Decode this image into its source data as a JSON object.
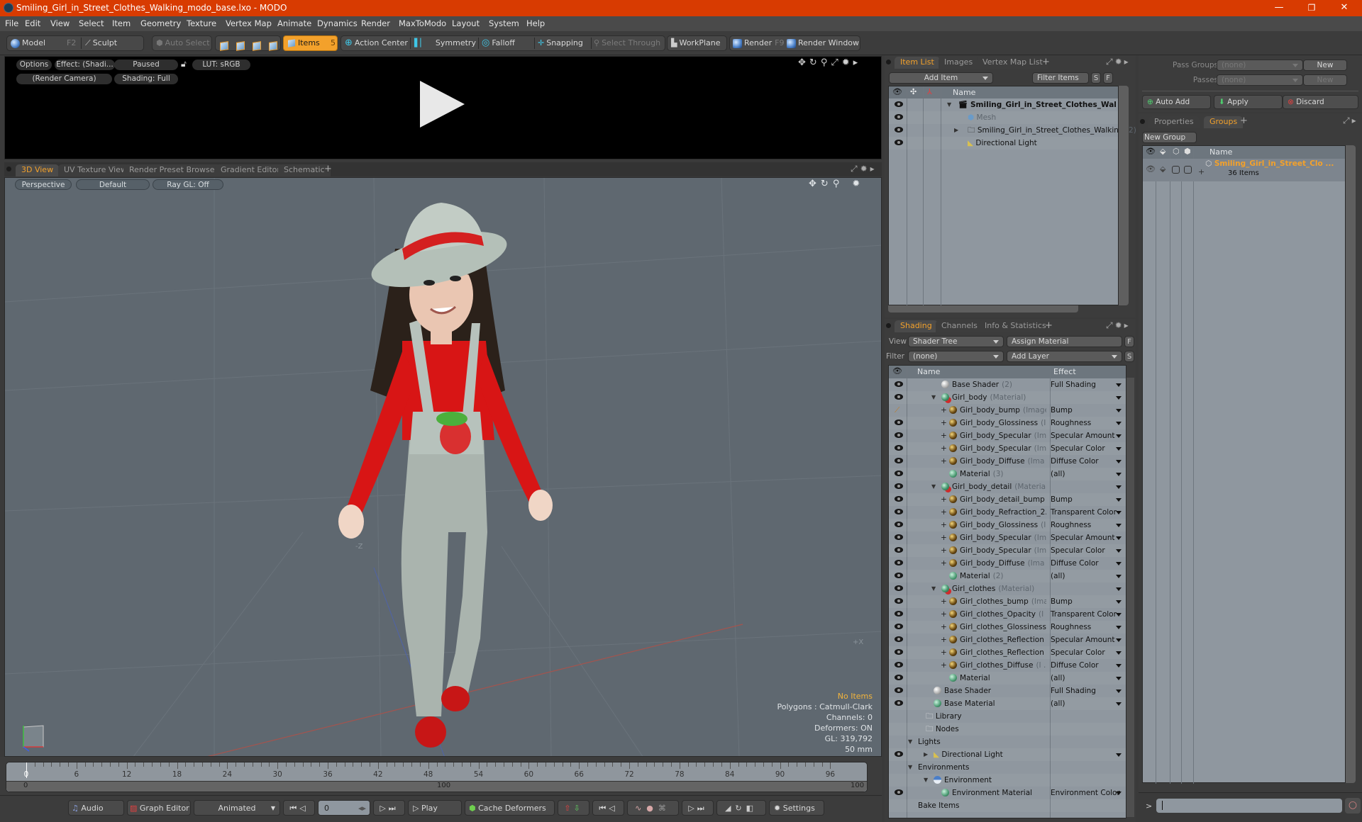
{
  "window": {
    "title": "Smiling_Girl_in_Street_Clothes_Walking_modo_base.lxo - MODO",
    "controls": {
      "minimize": "—",
      "restore": "❐",
      "close": "✕"
    }
  },
  "menu": [
    "File",
    "Edit",
    "View",
    "Select",
    "Item",
    "Geometry",
    "Texture",
    "Vertex Map",
    "Animate",
    "Dynamics",
    "Render",
    "MaxToModo",
    "Layout",
    "System",
    "Help"
  ],
  "toolbar": {
    "model": "Model",
    "model_key": "F2",
    "sculpt": "Sculpt",
    "auto_select": "Auto Select",
    "items": "Items",
    "items_key": "5",
    "action_center": "Action Center",
    "symmetry": "Symmetry",
    "falloff": "Falloff",
    "snapping": "Snapping",
    "select_through": "Select Through",
    "workplane": "WorkPlane",
    "render": "Render",
    "render_key": "F9",
    "render_window": "Render Window"
  },
  "render_preview": {
    "options": "Options",
    "effect": "Effect: (Shadi...",
    "paused": "Paused",
    "lut": "LUT: sRGB",
    "camera": "(Render Camera)",
    "shading": "Shading: Full"
  },
  "viewport_tabs": [
    "3D View",
    "UV Texture View",
    "Render Preset Browser",
    "Gradient Editor",
    "Schematic",
    "+"
  ],
  "viewport": {
    "projection": "Perspective",
    "style": "Default",
    "raygl": "Ray GL: Off",
    "axis_labels": {
      "x": "+X",
      "z": "-Z"
    },
    "stats": {
      "selection": "No Items",
      "polygons": "Polygons : Catmull-Clark",
      "channels": "Channels: 0",
      "deformers": "Deformers: ON",
      "gl": "GL: 319,792",
      "lens": "50 mm"
    }
  },
  "timeline": {
    "ticks": [
      "0",
      "6",
      "12",
      "18",
      "24",
      "30",
      "36",
      "42",
      "48",
      "54",
      "60",
      "66",
      "72",
      "78",
      "84",
      "90",
      "96"
    ],
    "range_start": "0",
    "range_mid": "100",
    "range_end": "100",
    "current_frame": 0
  },
  "bottom_bar": {
    "audio": "Audio",
    "graph_editor": "Graph Editor",
    "animated": "Animated",
    "frame": "0",
    "play": "Play",
    "cache_deformers": "Cache Deformers",
    "settings": "Settings"
  },
  "item_list": {
    "tabs": [
      "Item List",
      "Images",
      "Vertex Map List",
      "+"
    ],
    "add_item": "Add Item",
    "filter": "Filter Items",
    "s": "S",
    "f": "F",
    "column_name": "Name",
    "rows": [
      {
        "name": "Smiling_Girl_in_Street_Clothes_Wal ...",
        "suffix": "",
        "bold": true
      },
      {
        "name": "Mesh",
        "suffix": "",
        "dim": true
      },
      {
        "name": "Smiling_Girl_in_Street_Clothes_Walking",
        "suffix": "(2)"
      },
      {
        "name": "Directional Light",
        "suffix": ""
      }
    ]
  },
  "shading": {
    "tabs": [
      "Shading",
      "Channels",
      "Info & Statistics",
      "+"
    ],
    "view_label": "View",
    "view_value": "Shader Tree",
    "assign_material": "Assign Material",
    "f": "F",
    "filter_label": "Filter",
    "filter_value": "(none)",
    "add_layer": "Add Layer",
    "s": "S",
    "col_name": "Name",
    "col_effect": "Effect",
    "rows": [
      {
        "name": "Base Shader",
        "suffix": "(2)",
        "effect": "Full Shading",
        "icon": "white",
        "indent": 4,
        "eye": true
      },
      {
        "name": "Girl_body",
        "suffix": "(Material)",
        "effect": "",
        "icon": "mat",
        "indent": 4,
        "eye": true,
        "expand": true
      },
      {
        "name": "Girl_body_bump",
        "suffix": "(Image)",
        "effect": "Bump",
        "icon": "gold",
        "indent": 5,
        "eye": "brush",
        "plus": true
      },
      {
        "name": "Girl_body_Glossiness",
        "suffix": "(I ...",
        "effect": "Roughness",
        "icon": "gold",
        "indent": 5,
        "eye": true,
        "plus": true
      },
      {
        "name": "Girl_body_Specular",
        "suffix": "(Im ...",
        "effect": "Specular Amount",
        "icon": "gold",
        "indent": 5,
        "eye": true,
        "plus": true
      },
      {
        "name": "Girl_body_Specular",
        "suffix": "(Im ...",
        "effect": "Specular Color",
        "icon": "gold",
        "indent": 5,
        "eye": true,
        "plus": true
      },
      {
        "name": "Girl_body_Diffuse",
        "suffix": "(Ima ...",
        "effect": "Diffuse Color",
        "icon": "gold",
        "indent": 5,
        "eye": true,
        "plus": true
      },
      {
        "name": "Material",
        "suffix": "(3)",
        "effect": "(all)",
        "icon": "green",
        "indent": 5,
        "eye": true
      },
      {
        "name": "Girl_body_detail",
        "suffix": "(Material)",
        "effect": "",
        "icon": "mat",
        "indent": 4,
        "eye": true,
        "expand": true
      },
      {
        "name": "Girl_body_detail_bump",
        "suffix": "...",
        "effect": "Bump",
        "icon": "gold",
        "indent": 5,
        "eye": true,
        "plus": true
      },
      {
        "name": "Girl_body_Refraction_2...",
        "suffix": "",
        "effect": "Transparent Color",
        "icon": "gold",
        "indent": 5,
        "eye": true,
        "plus": true
      },
      {
        "name": "Girl_body_Glossiness",
        "suffix": "(I ...",
        "effect": "Roughness",
        "icon": "gold",
        "indent": 5,
        "eye": true,
        "plus": true
      },
      {
        "name": "Girl_body_Specular",
        "suffix": "(Im ...",
        "effect": "Specular Amount",
        "icon": "gold",
        "indent": 5,
        "eye": true,
        "plus": true
      },
      {
        "name": "Girl_body_Specular",
        "suffix": "(Im ...",
        "effect": "Specular Color",
        "icon": "gold",
        "indent": 5,
        "eye": true,
        "plus": true
      },
      {
        "name": "Girl_body_Diffuse",
        "suffix": "(Ima ...",
        "effect": "Diffuse Color",
        "icon": "gold",
        "indent": 5,
        "eye": true,
        "plus": true
      },
      {
        "name": "Material",
        "suffix": "(2)",
        "effect": "(all)",
        "icon": "green",
        "indent": 5,
        "eye": true
      },
      {
        "name": "Girl_clothes",
        "suffix": "(Material)",
        "effect": "",
        "icon": "mat",
        "indent": 4,
        "eye": true,
        "expand": true
      },
      {
        "name": "Girl_clothes_bump",
        "suffix": "(Ima...",
        "effect": "Bump",
        "icon": "gold",
        "indent": 5,
        "eye": true,
        "plus": true
      },
      {
        "name": "Girl_clothes_Opacity",
        "suffix": "(I ...",
        "effect": "Transparent Color",
        "icon": "gold",
        "indent": 5,
        "eye": true,
        "plus": true
      },
      {
        "name": "Girl_clothes_Glossiness",
        "suffix": "...",
        "effect": "Roughness",
        "icon": "gold",
        "indent": 5,
        "eye": true,
        "plus": true
      },
      {
        "name": "Girl_clothes_Reflection",
        "suffix": "...",
        "effect": "Specular Amount",
        "icon": "gold",
        "indent": 5,
        "eye": true,
        "plus": true
      },
      {
        "name": "Girl_clothes_Reflection",
        "suffix": "...",
        "effect": "Specular Color",
        "icon": "gold",
        "indent": 5,
        "eye": true,
        "plus": true
      },
      {
        "name": "Girl_clothes_Diffuse",
        "suffix": "(I ...",
        "effect": "Diffuse Color",
        "icon": "gold",
        "indent": 5,
        "eye": true,
        "plus": true
      },
      {
        "name": "Material",
        "suffix": "",
        "effect": "(all)",
        "icon": "green",
        "indent": 5,
        "eye": true
      },
      {
        "name": "Base Shader",
        "suffix": "",
        "effect": "Full Shading",
        "icon": "white",
        "indent": 3,
        "eye": true
      },
      {
        "name": "Base Material",
        "suffix": "",
        "effect": "(all)",
        "icon": "green",
        "indent": 3,
        "eye": true
      },
      {
        "name": "Library",
        "suffix": "",
        "effect": "",
        "icon": "folder",
        "indent": 2
      },
      {
        "name": "Nodes",
        "suffix": "",
        "effect": "",
        "icon": "folder",
        "indent": 2
      },
      {
        "name": "Lights",
        "suffix": "",
        "effect": "",
        "icon": "",
        "indent": 1,
        "expand": true
      },
      {
        "name": "Directional Light",
        "suffix": "",
        "effect": "",
        "icon": "light",
        "indent": 3,
        "eye": true,
        "collapsed": true
      },
      {
        "name": "Environments",
        "suffix": "",
        "effect": "",
        "icon": "",
        "indent": 1,
        "expand": true
      },
      {
        "name": "Environment",
        "suffix": "",
        "effect": "",
        "icon": "env",
        "indent": 3,
        "expand": true
      },
      {
        "name": "Environment Material",
        "suffix": "",
        "effect": "Environment Color",
        "icon": "green",
        "indent": 4,
        "eye": true
      },
      {
        "name": "Bake Items",
        "suffix": "",
        "effect": "",
        "icon": "",
        "indent": 1
      }
    ]
  },
  "passes": {
    "pass_groups_label": "Pass Groups",
    "pass_groups_value": "(none)",
    "passes_label": "Passes",
    "passes_value": "(none)",
    "new": "New",
    "auto_add": "Auto Add",
    "apply": "Apply",
    "discard": "Discard"
  },
  "groups": {
    "tabs": [
      "Properties",
      "Groups",
      "+"
    ],
    "new_group": "New Group",
    "col_name": "Name",
    "group_name": "Smiling_Girl_in_Street_Clo ...",
    "group_count": "36 Items"
  },
  "command": {
    "prompt": ">",
    "value": ""
  },
  "colors": {
    "accent": "#f3a12b",
    "titlebar": "#d83b01",
    "viewport": "#5f6870",
    "list_bg": "#8f979f"
  }
}
